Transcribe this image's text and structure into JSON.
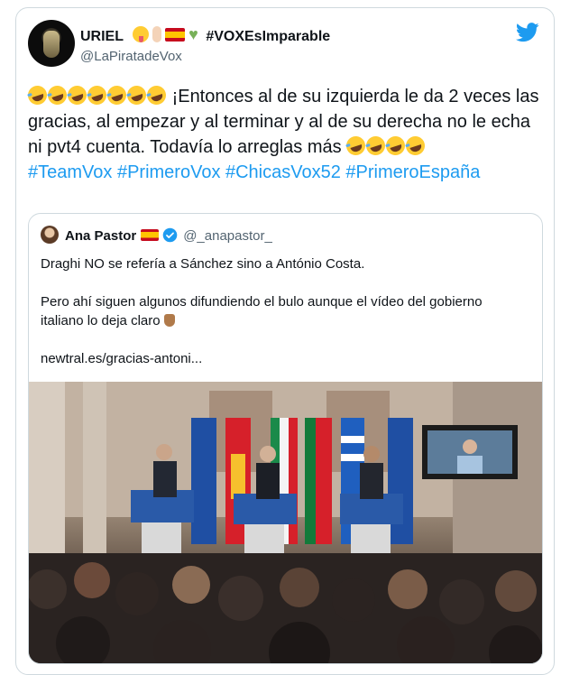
{
  "tweet": {
    "author_name": "URIEL",
    "name_hashtag": "#VOXEsImparable",
    "handle": "@LaPiratadeVox",
    "text_main": "¡Entonces al de su izquierda le da 2 veces las gracias, al empezar y al terminar y al de su derecha no le echa ni pvt4 cuenta. Todavía lo arreglas más",
    "hashtags": "#TeamVox #PrimeroVox #ChicasVox52 #PrimeroEspaña"
  },
  "quoted": {
    "author_name": "Ana Pastor",
    "handle": "@_anapastor_",
    "para1": "Draghi NO se refería a Sánchez sino a António Costa.",
    "para2": "Pero ahí siguen algunos difundiendo el bulo aunque el vídeo del gobierno italiano lo deja claro",
    "link": "newtral.es/gracias-antoni..."
  },
  "colors": {
    "accent": "#1d9bf0",
    "text": "#0f1419",
    "secondary": "#536471",
    "border": "#cfd9de"
  },
  "icons": {
    "brand": "twitter-bird-icon",
    "verified": "verified-badge-icon"
  }
}
